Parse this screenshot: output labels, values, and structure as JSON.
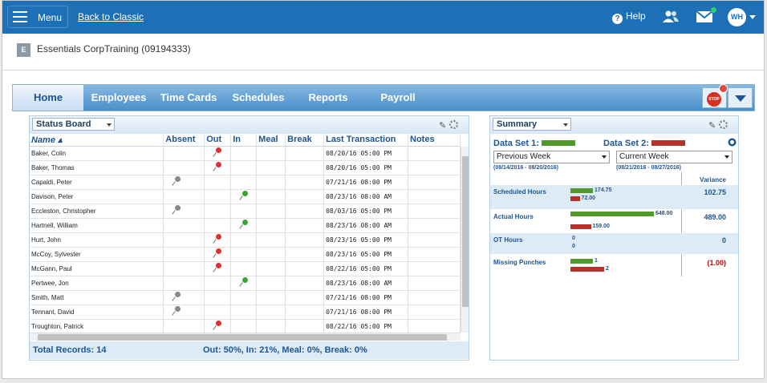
{
  "topbar": {
    "menu_label": "Menu",
    "back_label": "Back to Classic",
    "help_label": "Help",
    "avatar_initials": "WH"
  },
  "company": {
    "badge": "E",
    "name": "Essentials CorpTraining (09194333)"
  },
  "nav": {
    "tabs": [
      "Home",
      "Employees",
      "Time Cards",
      "Schedules",
      "Reports",
      "Payroll"
    ],
    "active": "Home",
    "stop_label": "STOP"
  },
  "status_board": {
    "title": "Status Board",
    "columns": [
      "Name ▴",
      "Absent",
      "Out",
      "In",
      "Meal",
      "Break",
      "Last Transaction",
      "Notes"
    ],
    "rows": [
      {
        "name": "Baker, Colin",
        "status": "out",
        "last": "08/20/16 05:00 PM"
      },
      {
        "name": "Baker, Thomas",
        "status": "out",
        "last": "08/20/16 05:00 PM"
      },
      {
        "name": "Capaldi, Peter",
        "status": "absent",
        "last": "07/21/16 08:00 PM"
      },
      {
        "name": "Davison, Peter",
        "status": "in",
        "last": "08/23/16 08:00 AM"
      },
      {
        "name": "Eccleston, Christopher",
        "status": "absent",
        "last": "08/03/16 05:00 PM"
      },
      {
        "name": "Hartnell, William",
        "status": "in",
        "last": "08/23/16 08:00 AM"
      },
      {
        "name": "Hurt, John",
        "status": "out",
        "last": "08/23/16 05:00 PM"
      },
      {
        "name": "McCoy, Sylvester",
        "status": "out",
        "last": "08/23/16 05:00 PM"
      },
      {
        "name": "McGann, Paul",
        "status": "out",
        "last": "08/22/16 05:00 PM"
      },
      {
        "name": "Pertwee, Jon",
        "status": "in",
        "last": "08/23/16 08:00 AM"
      },
      {
        "name": "Smith, Matt",
        "status": "absent",
        "last": "07/21/16 08:00 PM"
      },
      {
        "name": "Tennant, David",
        "status": "absent",
        "last": "07/21/16 08:00 PM"
      },
      {
        "name": "Troughton, Patrick",
        "status": "out",
        "last": "08/22/16 05:00 PM"
      }
    ],
    "total": "Total Records: 14",
    "stats": "Out: 50%, In: 21%, Meal: 0%, Break: 0%"
  },
  "summary": {
    "title": "Summary",
    "ds1_label": "Data Set 1:",
    "ds2_label": "Data Set 2:",
    "ds1_select": "Previous Week",
    "ds2_select": "Current Week",
    "ds1_range": "(08/14/2016 - 08/20/2016)",
    "ds2_range": "(08/21/2016 - 08/27/2016)",
    "variance_header": "Variance",
    "metrics": [
      {
        "label": "Scheduled Hours",
        "v1": "174.75",
        "v2": "72.00",
        "variance": "102.75"
      },
      {
        "label": "Actual Hours",
        "v1": "648.00",
        "v2": "159.00",
        "variance": "489.00"
      },
      {
        "label": "OT Hours",
        "v1": "0",
        "v2": "0",
        "variance": "0"
      },
      {
        "label": "Missing Punches",
        "v1": "1",
        "v2": "2",
        "variance": "(1.00)"
      }
    ]
  },
  "colors": {
    "topbar": "#1d6fb6",
    "set1": "#4f9a2a",
    "set2": "#b7302a",
    "negative": "#cc0000"
  }
}
